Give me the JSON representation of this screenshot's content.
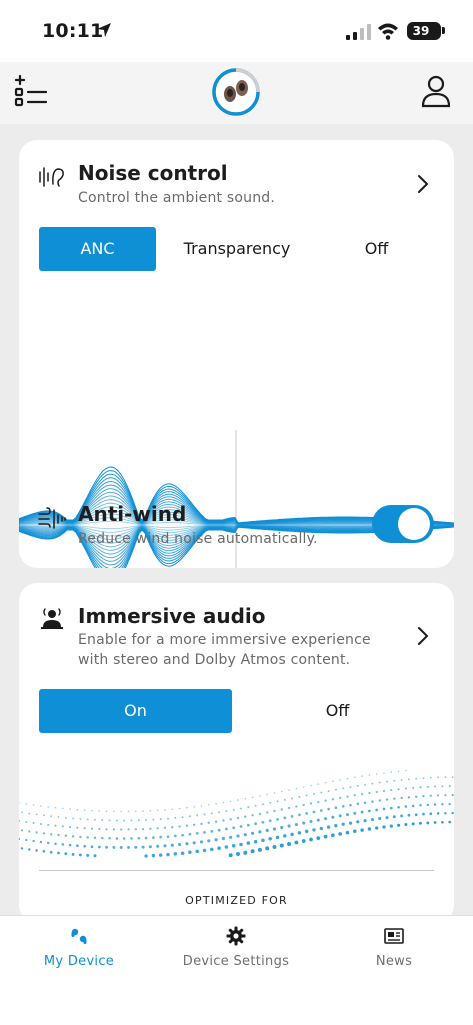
{
  "status_bar": {
    "time": "10:11",
    "battery": "39"
  },
  "header": {
    "menu_icon": "list-add-icon",
    "device_icon": "earbuds-icon",
    "profile_icon": "person-icon"
  },
  "noise_control": {
    "title": "Noise control",
    "subtitle": "Control the ambient sound.",
    "modes": [
      "ANC",
      "Transparency",
      "Off"
    ],
    "selected": "ANC"
  },
  "anti_wind": {
    "title": "Anti-wind",
    "subtitle": "Reduce wind noise automatically.",
    "enabled": true
  },
  "immersive_audio": {
    "title": "Immersive audio",
    "subtitle_line1": "Enable for a more immersive experience",
    "subtitle_line2": "with stereo and Dolby Atmos content.",
    "options": [
      "On",
      "Off"
    ],
    "selected": "On",
    "optimized_label": "OPTIMIZED FOR"
  },
  "tabs": [
    {
      "label": "My Device",
      "icon": "device-icon",
      "active": true
    },
    {
      "label": "Device Settings",
      "icon": "gear-icon",
      "active": false
    },
    {
      "label": "News",
      "icon": "news-icon",
      "active": false
    }
  ],
  "colors": {
    "accent": "#0f8fd6",
    "background": "#ececec",
    "card": "#ffffff"
  }
}
